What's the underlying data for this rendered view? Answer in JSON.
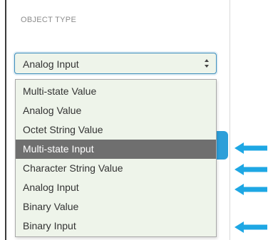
{
  "section_label": "OBJECT TYPE",
  "select": {
    "value": "Analog Input",
    "arrows_icon": "updown-chevron-icon"
  },
  "dropdown": {
    "options": [
      "Multi-state Value",
      "Analog Value",
      "Octet String Value",
      "Multi-state Input",
      "Character String Value",
      "Analog Input",
      "Binary Value",
      "Binary Input"
    ],
    "highlighted": "Multi-state Input"
  },
  "annotation_arrows": {
    "icon": "left-arrow-icon",
    "color": "#1ea7e4",
    "targets": [
      "Multi-state Input",
      "Character String Value",
      "Analog Input",
      "Binary Input"
    ]
  },
  "colors": {
    "accent": "#3c8dbc",
    "button_blue": "#2d9fd9",
    "highlight": "#6f6f6f",
    "field_bg": "#eef4ea"
  }
}
